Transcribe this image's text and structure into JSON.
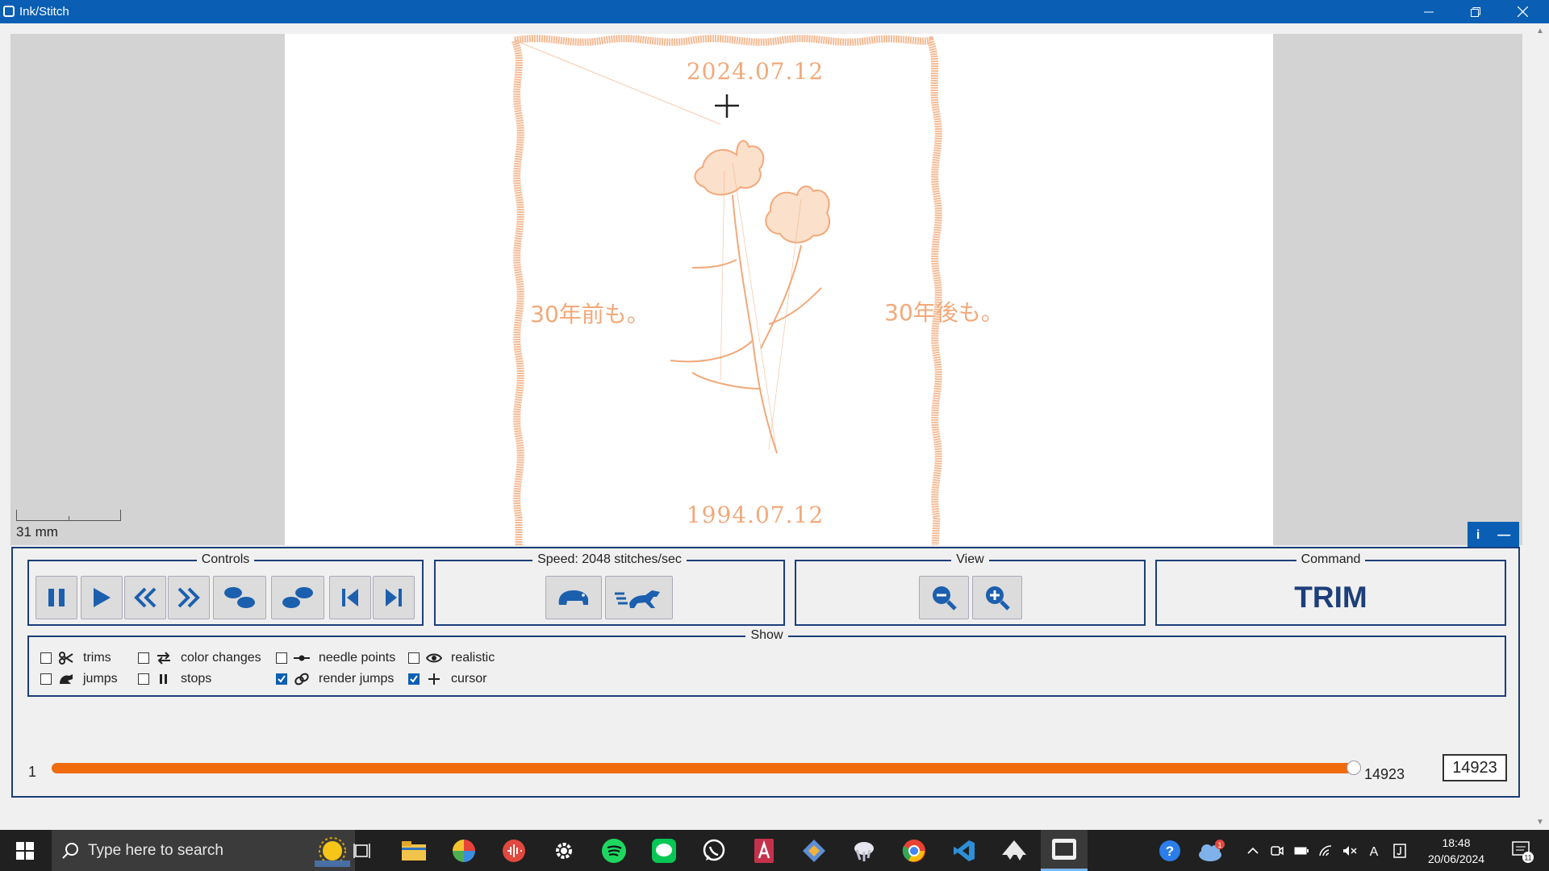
{
  "window": {
    "title": "Ink/Stitch"
  },
  "design": {
    "date_top": "2024.07.12",
    "date_bottom": "1994.07.12",
    "text_left": "30年前も。",
    "text_right": "30年後も。",
    "thread_color": "#f4b48a"
  },
  "scale": {
    "label": "31 mm"
  },
  "panel": {
    "info_label": "i",
    "collapse_label": "—",
    "controls": {
      "title": "Controls"
    },
    "speed": {
      "title": "Speed: 2048 stitches/sec"
    },
    "view": {
      "title": "View"
    },
    "command": {
      "title": "Command",
      "value": "TRIM"
    },
    "show": {
      "title": "Show",
      "items": [
        {
          "label": "trims",
          "checked": false
        },
        {
          "label": "color changes",
          "checked": false
        },
        {
          "label": "needle points",
          "checked": false
        },
        {
          "label": "realistic",
          "checked": false
        },
        {
          "label": "jumps",
          "checked": false
        },
        {
          "label": "stops",
          "checked": false
        },
        {
          "label": "render jumps",
          "checked": true
        },
        {
          "label": "cursor",
          "checked": true
        }
      ]
    },
    "slider": {
      "min": "1",
      "max": "14923",
      "value": "14923",
      "fraction": 1.0
    }
  },
  "taskbar": {
    "search_placeholder": "Type here to search",
    "time": "18:48",
    "date": "20/06/2024",
    "notification_count": "11",
    "weather_badge": "1"
  },
  "colors": {
    "accent": "#0a5fb4",
    "panel_border": "#1c3e7a",
    "slider": "#f06b0c"
  }
}
